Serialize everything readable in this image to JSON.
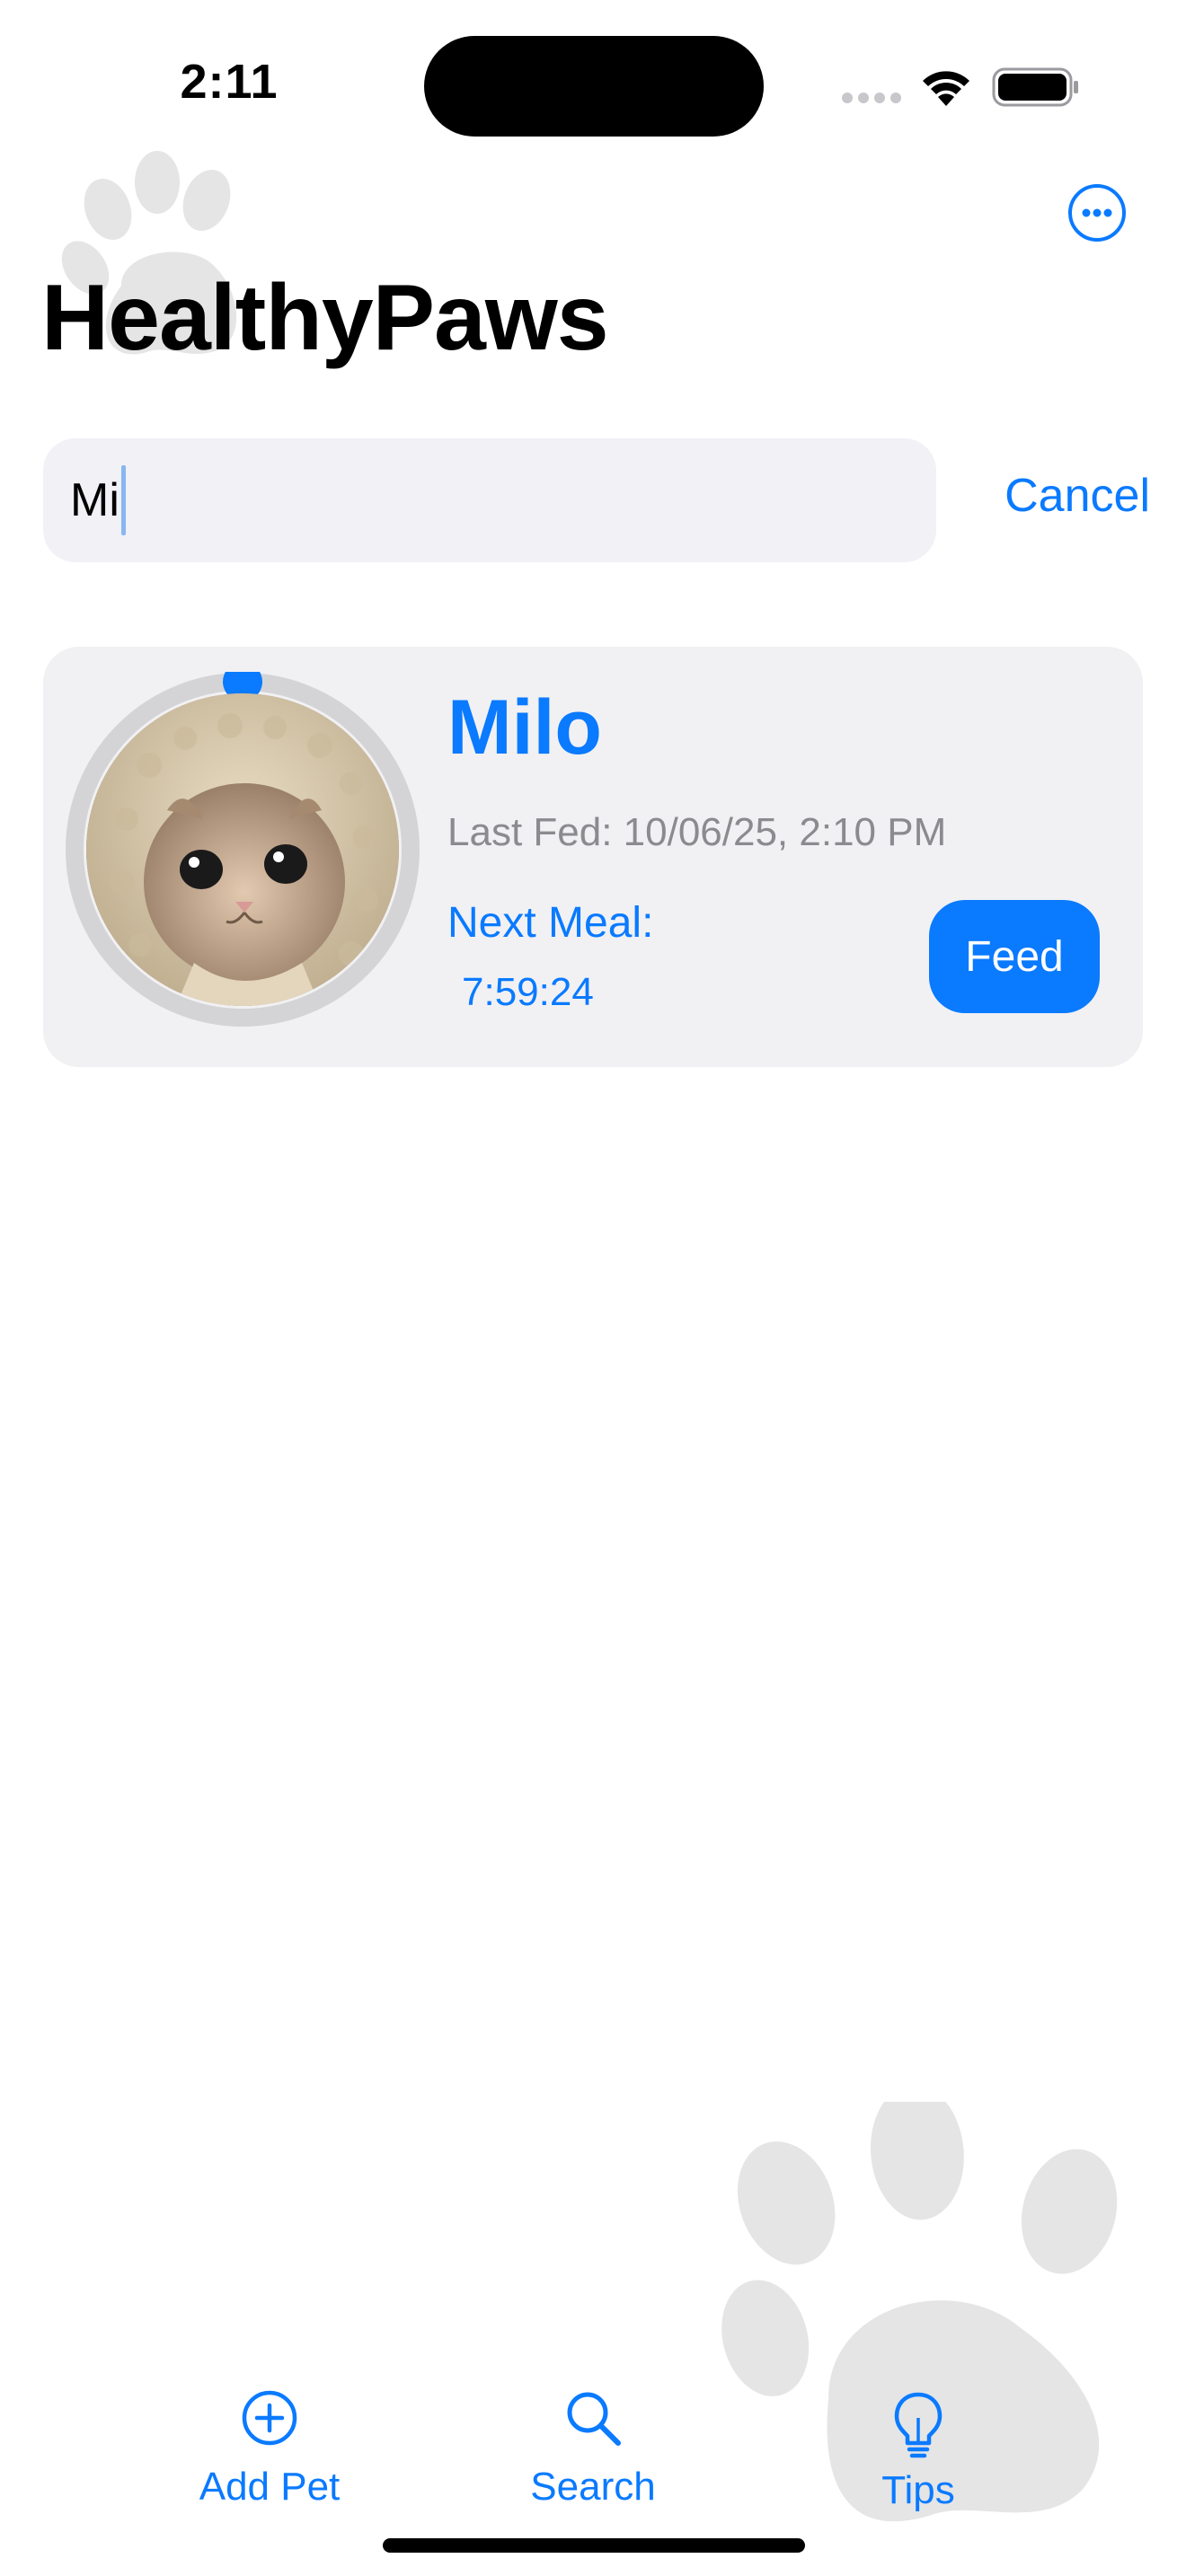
{
  "status_bar": {
    "time": "2:11"
  },
  "header": {
    "title": "HealthyPaws",
    "more_icon": "ellipsis-circle-icon"
  },
  "search": {
    "query": "Mi",
    "cancel_label": "Cancel"
  },
  "pets": [
    {
      "name": "Milo",
      "last_fed": "Last Fed: 10/06/25, 2:10 PM",
      "next_meal_label": "Next Meal:",
      "next_meal_countdown": "7:59:24",
      "feed_label": "Feed",
      "meal_progress": 0.0
    }
  ],
  "tab_bar": {
    "items": [
      {
        "label": "Add Pet",
        "icon": "plus-circle-icon"
      },
      {
        "label": "Search",
        "icon": "magnifier-icon"
      },
      {
        "label": "Tips",
        "icon": "lightbulb-icon"
      }
    ]
  },
  "colors": {
    "accent": "#0A7AFF",
    "card_background": "#F1F1F3",
    "search_background": "#F1F1F6",
    "secondary_text": "#8B8B8F",
    "paw_watermark": "#E5E5E5"
  }
}
